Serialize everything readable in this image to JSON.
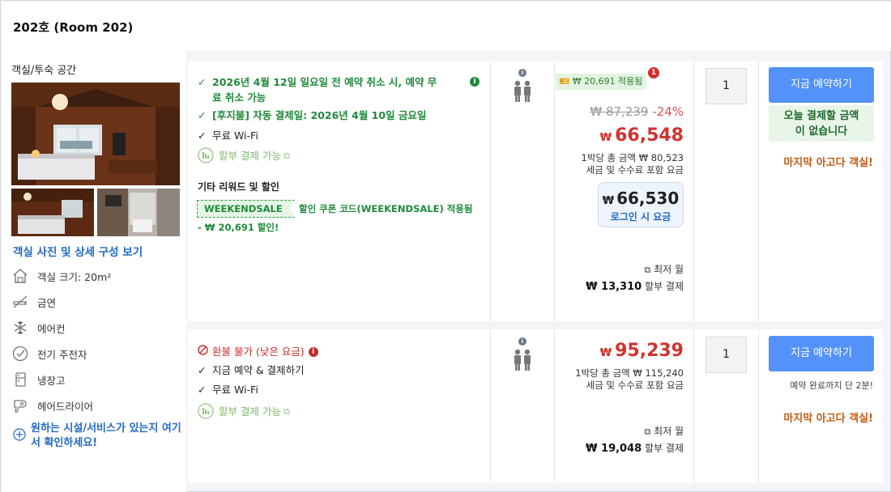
{
  "header": {
    "title": "202호 (Room 202)"
  },
  "left": {
    "room_type": "객실/투숙 공간",
    "photo_link": "객실 사진 및 상세 구성 보기",
    "amenities": [
      {
        "icon": "house-icon",
        "label": "객실 크기: 20m²"
      },
      {
        "icon": "no-smoking-icon",
        "label": "금연"
      },
      {
        "icon": "snowflake-icon",
        "label": "에어컨"
      },
      {
        "icon": "check-circle-icon",
        "label": "전기 주전자"
      },
      {
        "icon": "fridge-icon",
        "label": "냉장고"
      },
      {
        "icon": "hairdryer-icon",
        "label": "헤어드라이어"
      }
    ],
    "amenity_link": "원하는 시설/서비스가 있는지 여기서 확인하세요!"
  },
  "offers": [
    {
      "conditions": {
        "cancel": "2026년 4월 12일 일요일 전 예약 취소 시, 예약 무료 취소 가능",
        "cancel_line1": "2026년 4월 12일 일요일 전 예약 취소 시, 예약 무",
        "cancel_line2": "료 취소 가능",
        "postpay": "[후지불] 자동 결제일: 2026년 4월 10일 금요일",
        "wifi": "무료 Wi-Fi",
        "installment": "할부 결제 가능"
      },
      "reward_title": "기타 리워드 및 할인",
      "coupon_code": "WEEKENDSALE",
      "coupon_text_1": "할인 쿠폰 코드(WEEKENDSALE) 적용됨",
      "coupon_text_2": "- ₩ 20,691 할인!",
      "price": {
        "applied_badge": "₩ 20,691 적용됨",
        "badge_count": "1",
        "original": "₩ 87,239",
        "discount_pct": "-24%",
        "currency": "₩",
        "final": "66,548",
        "total_line1": "1박당 총 금액 ₩ 80,523",
        "total_line2": "세금 및 수수료 포함 요금",
        "login_price": "66,530",
        "login_label": "로그인 시 요금",
        "min_month": "최저 월",
        "monthly_amount": "₩ 13,310",
        "monthly_label": "할부 결제"
      },
      "quantity": "1",
      "book_label": "지금 예약하기",
      "no_pay_1": "오늘 결제할 금액",
      "no_pay_2": "이 없습니다",
      "last_room": "마지막 아고다 객실!"
    },
    {
      "conditions": {
        "refund": "환불 불가 (낮은 요금)",
        "pay_now": "지금 예약 & 결제하기",
        "wifi": "무료 Wi-Fi",
        "installment": "할부 결제 가능"
      },
      "price": {
        "currency": "₩",
        "final": "95,239",
        "total_line1": "1박당 총 금액 ₩ 115,240",
        "total_line2": "세금 및 수수료 포함 요금",
        "min_month": "최저 월",
        "monthly_amount": "₩ 19,048",
        "monthly_label": "할부 결제"
      },
      "quantity": "1",
      "book_label": "지금 예약하기",
      "few_minutes": "예약 완료까지 단 2분!",
      "last_room": "마지막 아고다 객실!"
    }
  ],
  "colors": {
    "accent_blue": "#5392f9",
    "green": "#1f8a3a",
    "price_red": "#d0332e",
    "orange": "#c25b12"
  }
}
